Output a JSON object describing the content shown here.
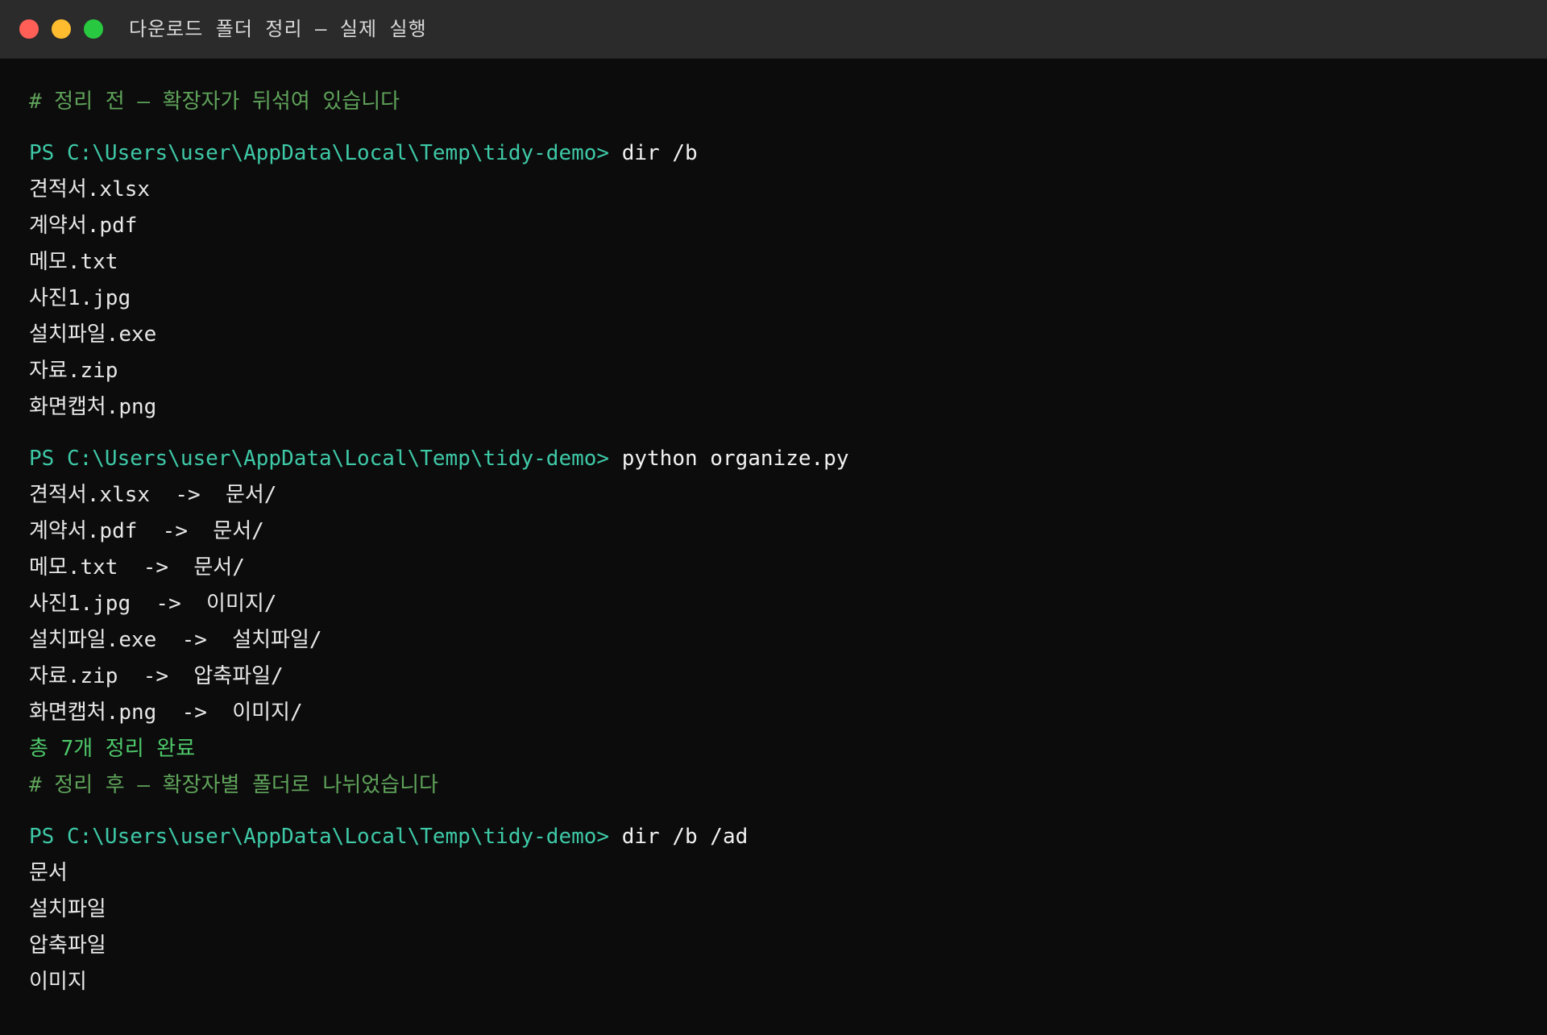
{
  "window": {
    "title": "다운로드 폴더 정리 — 실제 실행"
  },
  "terminal": {
    "comment_before": "# 정리 전 — 확장자가 뒤섞여 있습니다",
    "prompt": "PS C:\\Users\\user\\AppData\\Local\\Temp\\tidy-demo>",
    "command1": "dir /b",
    "files": [
      "견적서.xlsx",
      "계약서.pdf",
      "메모.txt",
      "사진1.jpg",
      "설치파일.exe",
      "자료.zip",
      "화면캡처.png"
    ],
    "command2": "python organize.py",
    "moves": [
      "견적서.xlsx  ->  문서/",
      "계약서.pdf  ->  문서/",
      "메모.txt  ->  문서/",
      "사진1.jpg  ->  이미지/",
      "설치파일.exe  ->  설치파일/",
      "자료.zip  ->  압축파일/",
      "화면캡처.png  ->  이미지/"
    ],
    "summary": "총 7개 정리 완료",
    "comment_after": "# 정리 후 — 확장자별 폴더로 나뉘었습니다",
    "command3": "dir /b /ad",
    "folders": [
      "문서",
      "설치파일",
      "압축파일",
      "이미지"
    ]
  }
}
